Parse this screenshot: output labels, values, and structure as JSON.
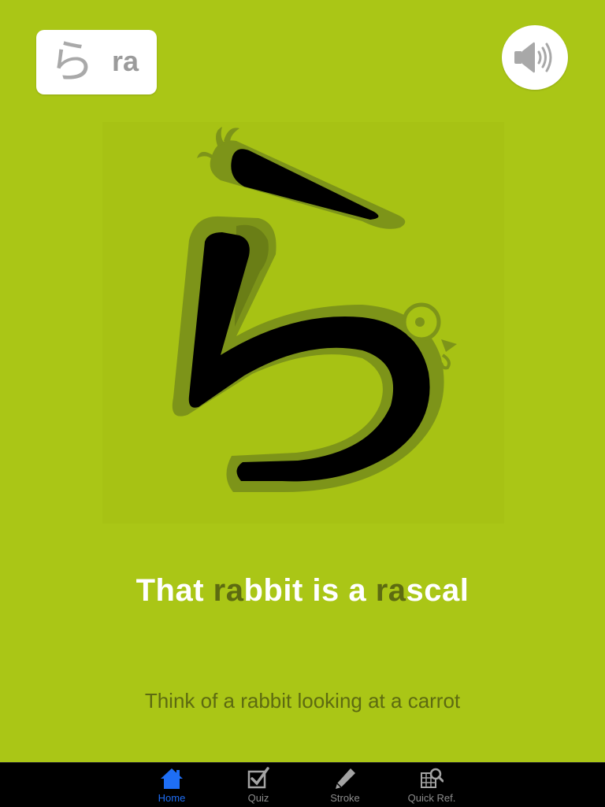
{
  "card": {
    "kana": "ら",
    "romaji": "ra"
  },
  "sound": {
    "icon": "speaker-icon"
  },
  "mnemonic": {
    "parts": [
      "That ",
      "ra",
      "bbit is a ",
      "ra",
      "scal"
    ]
  },
  "hint": "Think of a rabbit looking at a carrot",
  "tabs": [
    {
      "label": "Home",
      "icon": "home-icon",
      "active": true
    },
    {
      "label": "Quiz",
      "icon": "checkbox-icon",
      "active": false
    },
    {
      "label": "Stroke",
      "icon": "pencil-icon",
      "active": false
    },
    {
      "label": "Quick Ref.",
      "icon": "grid-search-icon",
      "active": false
    }
  ],
  "colors": {
    "background": "#aac616",
    "highlight": "#5d6b11",
    "active_tab": "#1e6ef5",
    "inactive_tab": "#8c8c8c"
  }
}
